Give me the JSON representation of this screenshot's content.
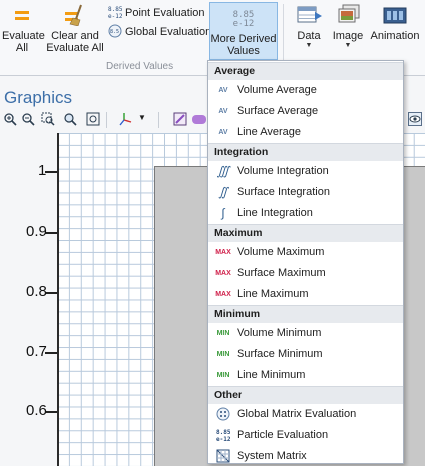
{
  "ribbon": {
    "evaluate_all": "Evaluate All",
    "evaluate_all_l1": "Evaluate",
    "evaluate_all_l2": "All",
    "clear_evaluate_l1": "Clear and",
    "clear_evaluate_l2": "Evaluate All",
    "point_eval_icon_text": "8.85\ne-12",
    "point_evaluation": "Point Evaluation",
    "global_eval_icon_text": "8.85",
    "global_evaluation": "Global Evaluation",
    "more_derived_num_1": "8.85",
    "more_derived_num_2": "e-12",
    "more_derived_l1": "More Derived",
    "more_derived_l2": "Values",
    "group_label": "Derived Values",
    "data": "Data",
    "image": "Image",
    "animation": "Animation"
  },
  "graphics": {
    "title": "Graphics",
    "y_ticks": [
      "1",
      "0.9",
      "0.8",
      "0.7",
      "0.6"
    ]
  },
  "menu": {
    "sections": [
      {
        "header": "Average",
        "items": [
          {
            "icon": "AV",
            "label": "Volume Average"
          },
          {
            "icon": "AV",
            "label": "Surface Average"
          },
          {
            "icon": "AV",
            "label": "Line Average"
          }
        ]
      },
      {
        "header": "Integration",
        "items": [
          {
            "icon": "∭",
            "label": "Volume Integration"
          },
          {
            "icon": "∬",
            "label": "Surface Integration"
          },
          {
            "icon": "∫",
            "label": "Line Integration"
          }
        ]
      },
      {
        "header": "Maximum",
        "items": [
          {
            "icon": "MAX",
            "label": "Volume Maximum"
          },
          {
            "icon": "MAX",
            "label": "Surface Maximum"
          },
          {
            "icon": "MAX",
            "label": "Line Maximum"
          }
        ]
      },
      {
        "header": "Minimum",
        "items": [
          {
            "icon": "MIN",
            "label": "Volume Minimum"
          },
          {
            "icon": "MIN",
            "label": "Surface Minimum"
          },
          {
            "icon": "MIN",
            "label": "Line Minimum"
          }
        ]
      },
      {
        "header": "Other",
        "items": [
          {
            "icon": "global-matrix-icon",
            "label": "Global Matrix Evaluation"
          },
          {
            "icon": "8.85 e-12",
            "label": "Particle Evaluation"
          },
          {
            "icon": "system-matrix-icon",
            "label": "System Matrix"
          }
        ]
      }
    ]
  },
  "colors": {
    "accent_orange": "#f39c12",
    "selected_blue": "#cde3f7",
    "max_red": "#d0204a",
    "min_green": "#3a9a3a",
    "graphics_title": "#3d6fa8"
  }
}
